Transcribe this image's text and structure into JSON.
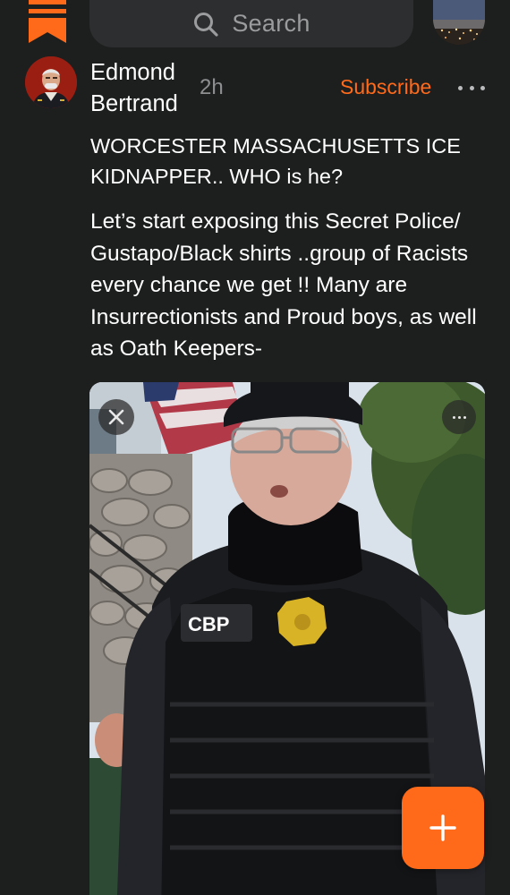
{
  "search": {
    "placeholder": "Search"
  },
  "post": {
    "author": "Edmond Bertrand",
    "time": "2h",
    "subscribe_label": "Subscribe",
    "title": "WORCESTER MASSACHUSETTS ICE KIDNAPPER.. WHO is he?",
    "body": "Let’s start exposing this Secret Police/ Gustapo/Black shirts ..group of Racists every chance we get !! Many are Insurrectionists and Proud boys, as well as Oath Keepers-",
    "media": {
      "vest_patch_text": "CBP"
    }
  },
  "colors": {
    "accent": "#ff6a1a",
    "background": "#1d1f1f",
    "search_bg": "#2c2e2f",
    "muted_text": "#8d8f90"
  },
  "icons": {
    "logo": "substack-logo-icon",
    "search": "search-icon",
    "more": "more-horizontal-icon",
    "close": "close-icon",
    "compose": "plus-icon"
  }
}
